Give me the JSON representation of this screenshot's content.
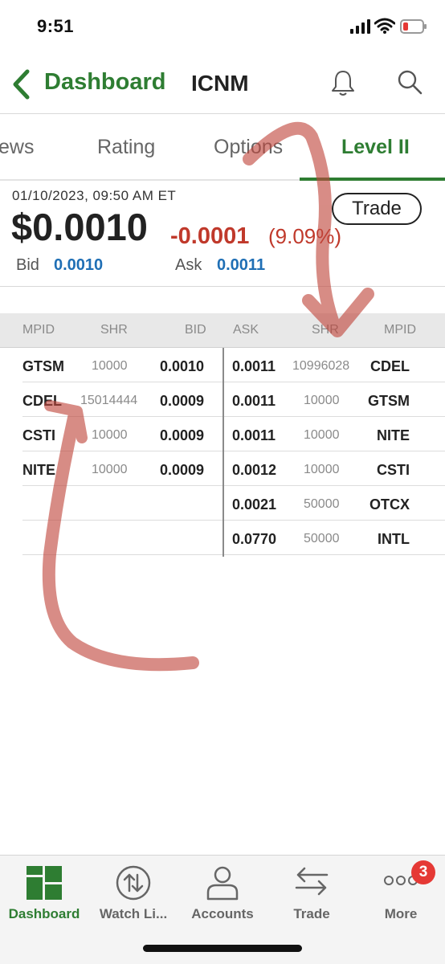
{
  "status_bar": {
    "time": "9:51"
  },
  "nav": {
    "back_label": "Dashboard",
    "title": "ICNM"
  },
  "tabs": [
    {
      "label": "ews",
      "active": false
    },
    {
      "label": "Rating",
      "active": false
    },
    {
      "label": "Options",
      "active": false
    },
    {
      "label": "Level II",
      "active": true
    }
  ],
  "quote": {
    "timestamp": "01/10/2023, 09:50 AM ET",
    "price": "$0.0010",
    "change": "-0.0001",
    "change_pct": "(9.09%)",
    "trade_label": "Trade",
    "bid_label": "Bid",
    "bid_value": "0.0010",
    "ask_label": "Ask",
    "ask_value": "0.0011"
  },
  "level2": {
    "headers": {
      "mpid_left": "MPID",
      "shr_left": "SHR",
      "bid": "BID",
      "ask": "ASK",
      "shr_right": "SHR",
      "mpid_right": "MPID"
    },
    "bids": [
      {
        "mpid": "GTSM",
        "shr": "10000",
        "price": "0.0010"
      },
      {
        "mpid": "CDEL",
        "shr": "15014444",
        "price": "0.0009"
      },
      {
        "mpid": "CSTI",
        "shr": "10000",
        "price": "0.0009"
      },
      {
        "mpid": "NITE",
        "shr": "10000",
        "price": "0.0009"
      },
      {
        "mpid": "",
        "shr": "",
        "price": ""
      },
      {
        "mpid": "",
        "shr": "",
        "price": ""
      }
    ],
    "asks": [
      {
        "price": "0.0011",
        "shr": "10996028",
        "mpid": "CDEL"
      },
      {
        "price": "0.0011",
        "shr": "10000",
        "mpid": "GTSM"
      },
      {
        "price": "0.0011",
        "shr": "10000",
        "mpid": "NITE"
      },
      {
        "price": "0.0012",
        "shr": "10000",
        "mpid": "CSTI"
      },
      {
        "price": "0.0021",
        "shr": "50000",
        "mpid": "OTCX"
      },
      {
        "price": "0.0770",
        "shr": "50000",
        "mpid": "INTL"
      }
    ]
  },
  "tabbar": {
    "items": [
      {
        "label": "Dashboard",
        "icon": "dashboard-grid-icon",
        "active": true
      },
      {
        "label": "Watch Li...",
        "icon": "watchlist-arrows-icon",
        "active": false
      },
      {
        "label": "Accounts",
        "icon": "person-icon",
        "active": false
      },
      {
        "label": "Trade",
        "icon": "swap-arrows-icon",
        "active": false
      },
      {
        "label": "More",
        "icon": "more-dots-icon",
        "active": false
      }
    ],
    "more_badge": "3"
  },
  "colors": {
    "brand_green": "#2e7d32",
    "negative_red": "#c0392b",
    "link_blue": "#1f6fb5",
    "annotation_red": "#c0463c"
  }
}
